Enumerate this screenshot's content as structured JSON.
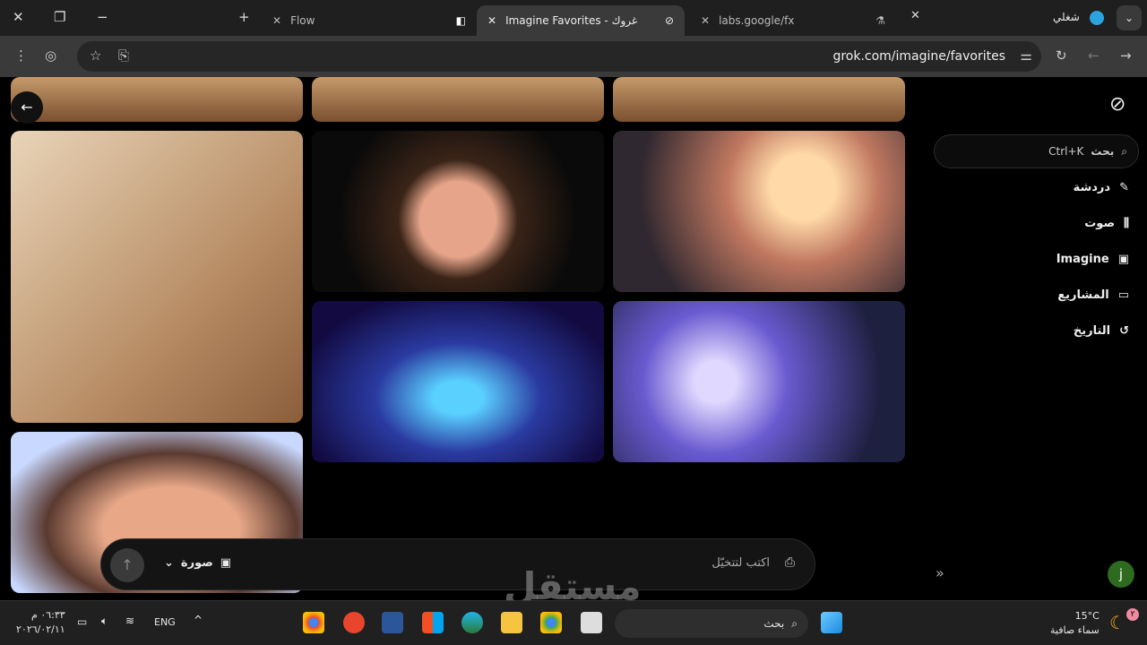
{
  "browser": {
    "tabs": [
      {
        "label": "Flow"
      },
      {
        "label": "Imagine Favorites - غروك",
        "active": true
      },
      {
        "label": "labs.google/fx"
      }
    ],
    "profile_label": "شغلي",
    "url": "grok.com/imagine/favorites"
  },
  "sidebar": {
    "search_label": "بحث",
    "search_shortcut": "Ctrl+K",
    "items": [
      {
        "label": "دردشة",
        "icon": "edit-icon"
      },
      {
        "label": "صوت",
        "icon": "waveform-icon"
      },
      {
        "label": "Imagine",
        "icon": "image-icon"
      },
      {
        "label": "المشاريع",
        "icon": "folder-icon"
      },
      {
        "label": "التاريخ",
        "icon": "history-icon"
      }
    ],
    "avatar": "j",
    "collapse": "»"
  },
  "composer": {
    "placeholder": "اكتب لتتخيّل",
    "mode": "صورة"
  },
  "taskbar": {
    "weather_temp": "15°C",
    "weather_desc": "سماء صافية",
    "search": "بحث",
    "lang": "ENG",
    "time": "٠٦:٣٣ م",
    "date": "٢٠٢٦/٠٢/١١",
    "badge": "٢"
  },
  "watermark": "مستقل"
}
